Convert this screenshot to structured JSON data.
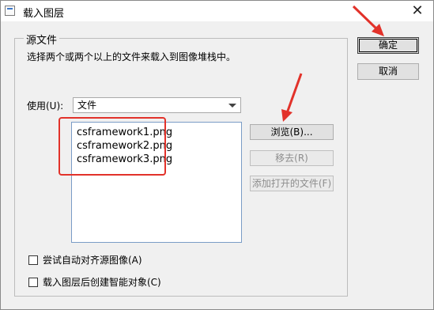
{
  "window": {
    "title": "载入图层"
  },
  "group": {
    "legend": "源文件",
    "description": "选择两个或两个以上的文件来载入到图像堆栈中。"
  },
  "use_field": {
    "label": "使用(U):",
    "selected": "文件"
  },
  "files": [
    "csframework1.png",
    "csframework2.png",
    "csframework3.png"
  ],
  "buttons": {
    "ok": "确定",
    "cancel": "取消",
    "browse": "浏览(B)...",
    "remove": "移去(R)",
    "add_open": "添加打开的文件(F)"
  },
  "checkboxes": {
    "auto_align": "尝试自动对齐源图像(A)",
    "smart_object": "载入图层后创建智能对象(C)"
  },
  "colors": {
    "annotation": "#e2322a"
  }
}
